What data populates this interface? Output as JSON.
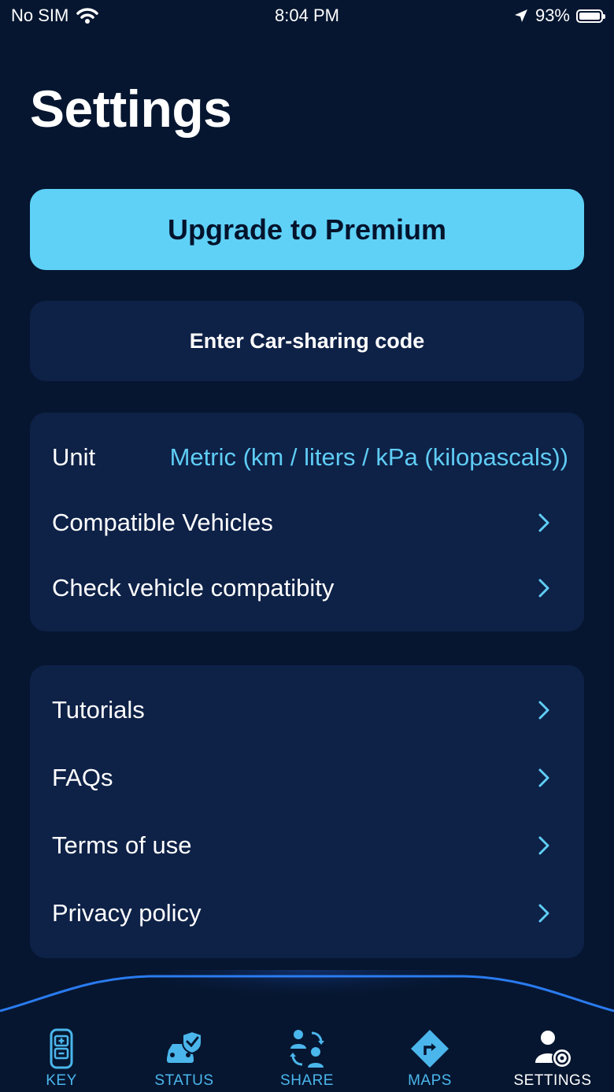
{
  "status_bar": {
    "carrier": "No SIM",
    "time": "8:04 PM",
    "battery": "93%"
  },
  "title": "Settings",
  "premium_button": "Upgrade to Premium",
  "car_sharing_button": "Enter Car-sharing code",
  "settings_group": {
    "unit_label": "Unit",
    "unit_value": "Metric (km / liters / kPa (kilopascals))",
    "compatible_vehicles": "Compatible Vehicles",
    "check_compatibility": "Check vehicle compatibity"
  },
  "info_group": {
    "tutorials": "Tutorials",
    "faqs": "FAQs",
    "terms": "Terms of use",
    "privacy": "Privacy policy"
  },
  "tabs": {
    "key": "KEY",
    "status": "STATUS",
    "share": "SHARE",
    "maps": "MAPS",
    "settings": "SETTINGS"
  },
  "colors": {
    "background": "#061630",
    "card": "#0e2147",
    "accent": "#5fd1f7",
    "tab_inactive": "#4bb6ec"
  }
}
